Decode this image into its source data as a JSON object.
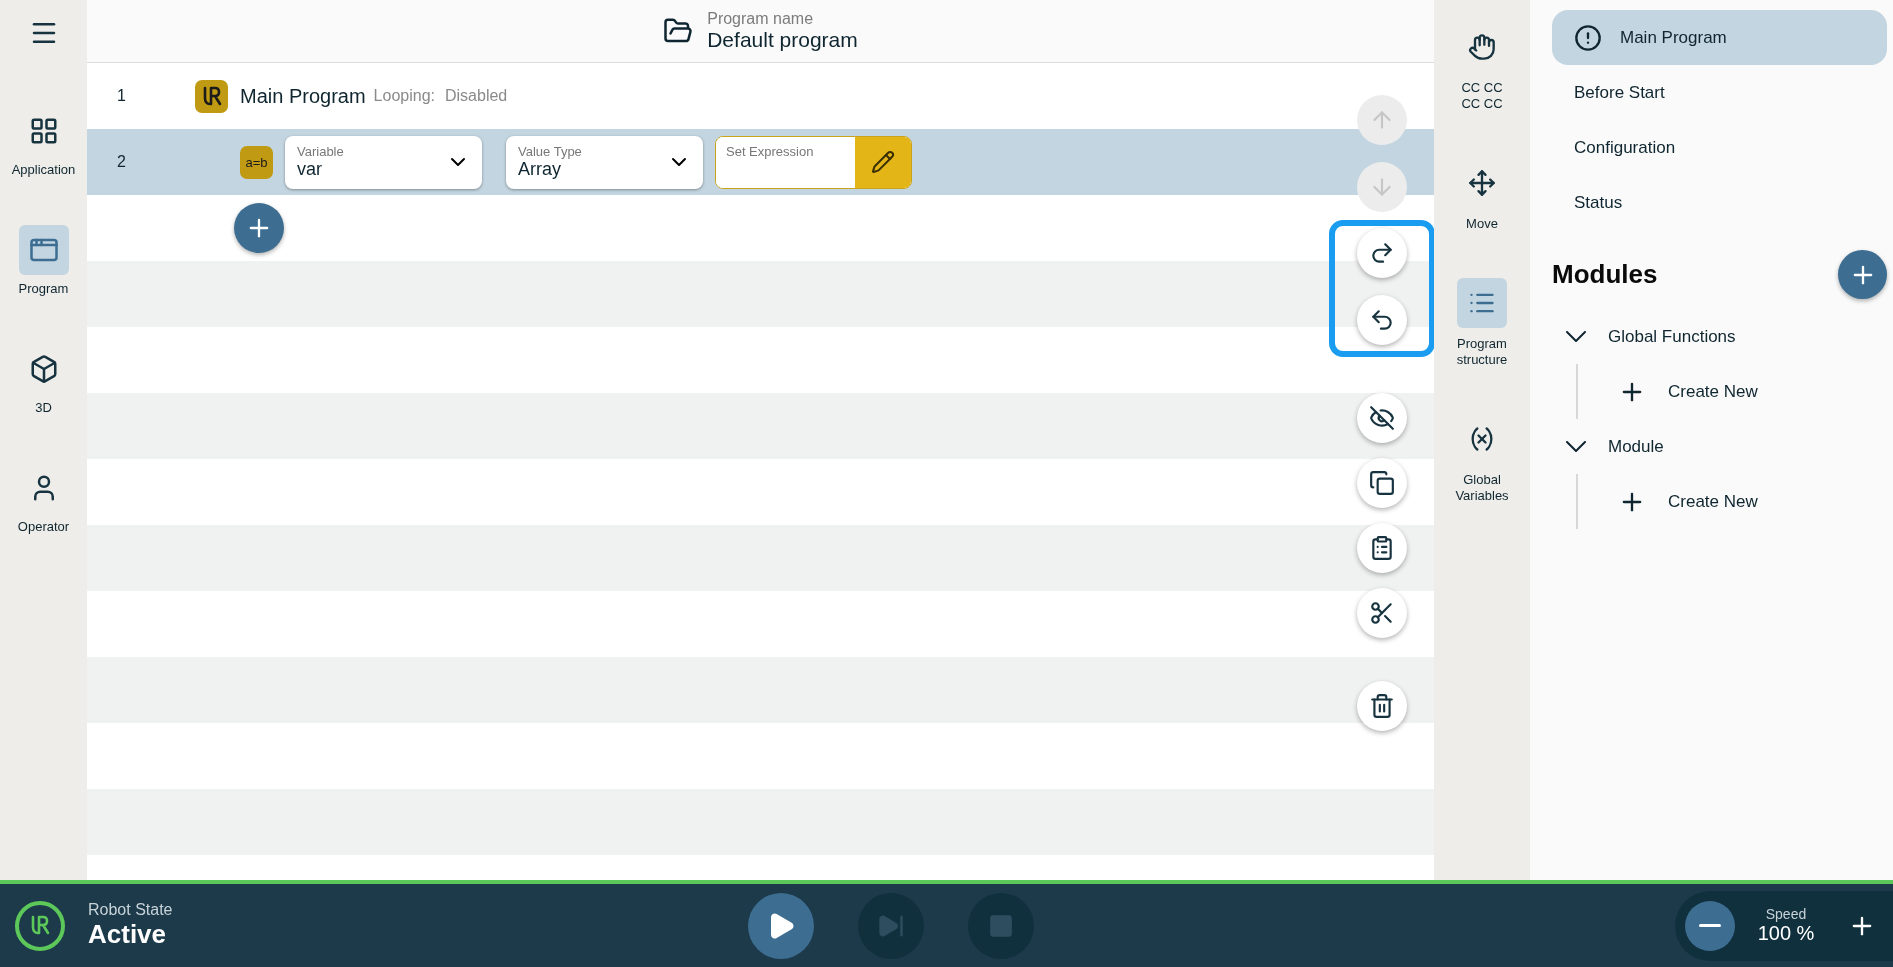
{
  "nav": {
    "items": [
      {
        "label": "Application",
        "kind": "grid",
        "selected": false
      },
      {
        "label": "Program",
        "kind": "window",
        "selected": true
      },
      {
        "label": "3D",
        "kind": "cube",
        "selected": false
      },
      {
        "label": "Operator",
        "kind": "person",
        "selected": false
      }
    ]
  },
  "header": {
    "caption": "Program name",
    "title": "Default program"
  },
  "program_rows": [
    {
      "number": "1",
      "kind": "main",
      "title": "Main Program",
      "looping_label": "Looping:",
      "looping_value": "Disabled",
      "selected": false
    },
    {
      "number": "2",
      "kind": "assignment",
      "badge": "a=b",
      "selected": true,
      "variable": {
        "label": "Variable",
        "value": "var"
      },
      "value_type": {
        "label": "Value Type",
        "value": "Array"
      },
      "expression": {
        "placeholder": "Set Expression"
      }
    }
  ],
  "actions": [
    {
      "kind": "up",
      "disabled": true,
      "highlighted": false
    },
    {
      "kind": "down",
      "disabled": true,
      "highlighted": false
    },
    {
      "kind": "redo",
      "disabled": false,
      "highlighted": true
    },
    {
      "kind": "undo",
      "disabled": false,
      "highlighted": true
    },
    {
      "kind": "hide",
      "disabled": false,
      "highlighted": false
    },
    {
      "kind": "copy",
      "disabled": false,
      "highlighted": false
    },
    {
      "kind": "paste",
      "disabled": false,
      "highlighted": false
    },
    {
      "kind": "cut",
      "disabled": false,
      "highlighted": false
    },
    {
      "kind": "delete",
      "disabled": false,
      "highlighted": false
    }
  ],
  "tool_rail": [
    {
      "kind": "hand",
      "label": "CC CC CC CC",
      "selected": false
    },
    {
      "kind": "move",
      "label": "Move",
      "selected": false
    },
    {
      "kind": "structure",
      "label": "Program structure",
      "selected": true
    },
    {
      "kind": "variables",
      "label": "Global Variables",
      "selected": false
    }
  ],
  "side_menu": [
    {
      "label": "Main Program",
      "selected": true
    },
    {
      "label": "Before Start",
      "selected": false
    },
    {
      "label": "Configuration",
      "selected": false
    },
    {
      "label": "Status",
      "selected": false
    }
  ],
  "modules": {
    "title": "Modules",
    "groups": [
      {
        "name": "Global Functions",
        "expanded": true,
        "children": [
          {
            "label": "Create New"
          }
        ]
      },
      {
        "name": "Module",
        "expanded": true,
        "children": [
          {
            "label": "Create New"
          }
        ]
      }
    ]
  },
  "status_bar": {
    "state_label": "Robot State",
    "state": "Active",
    "controls": [
      {
        "kind": "play",
        "disabled": false
      },
      {
        "kind": "step",
        "disabled": true
      },
      {
        "kind": "stop",
        "disabled": true
      }
    ],
    "speed_label": "Speed",
    "speed": "100 %"
  }
}
